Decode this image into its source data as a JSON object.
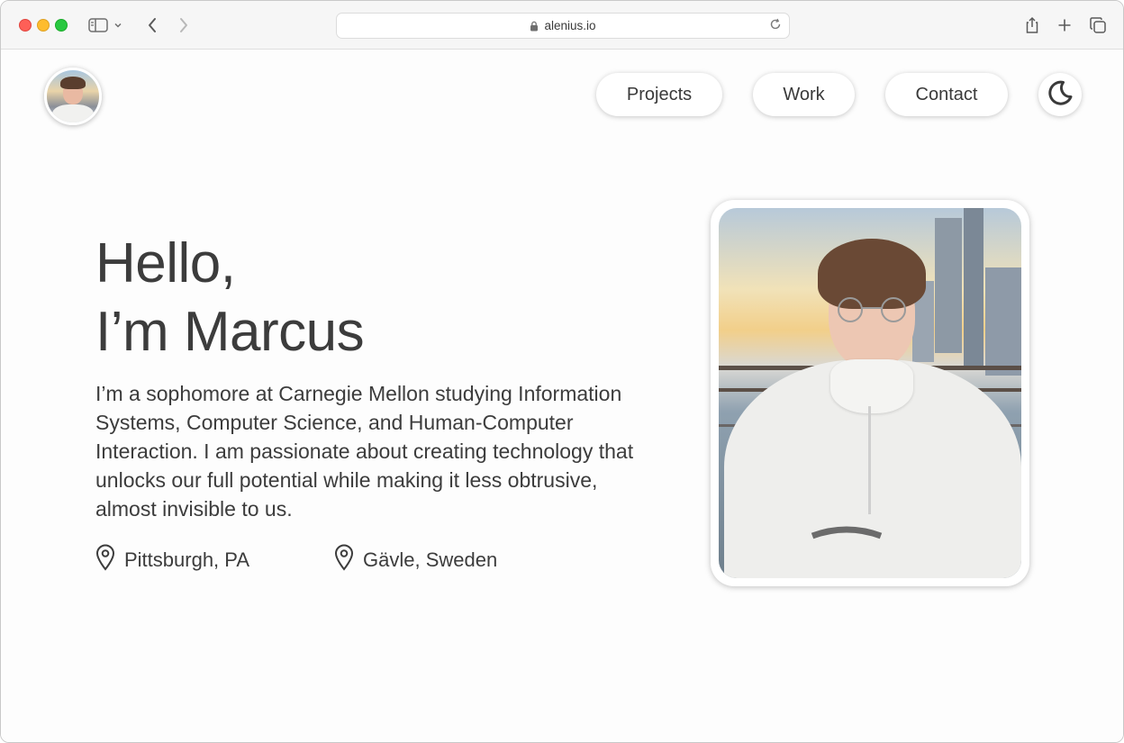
{
  "browser": {
    "url": "alenius.io"
  },
  "nav": {
    "items": [
      {
        "label": "Projects"
      },
      {
        "label": "Work"
      },
      {
        "label": "Contact"
      }
    ]
  },
  "hero": {
    "title_line1": "Hello,",
    "title_line2": "I’m Marcus",
    "bio": "I’m a sophomore at Carnegie Mellon studying Information Systems, Computer Science, and Human-Computer Interaction. I am passionate about creating technology that unlocks our full potential while making it less obtrusive, almost invisible to us.",
    "locations": [
      {
        "label": "Pittsburgh, PA",
        "icon": "map-pin-icon"
      },
      {
        "label": "Gävle, Sweden",
        "icon": "map-pin-icon"
      }
    ]
  },
  "theme": {
    "icon": "moon-icon"
  },
  "colors": {
    "text": "#3c3c3c",
    "background": "#fdfdfd",
    "close": "#fe5f57",
    "minimize": "#febc2e",
    "zoom": "#28c840"
  }
}
